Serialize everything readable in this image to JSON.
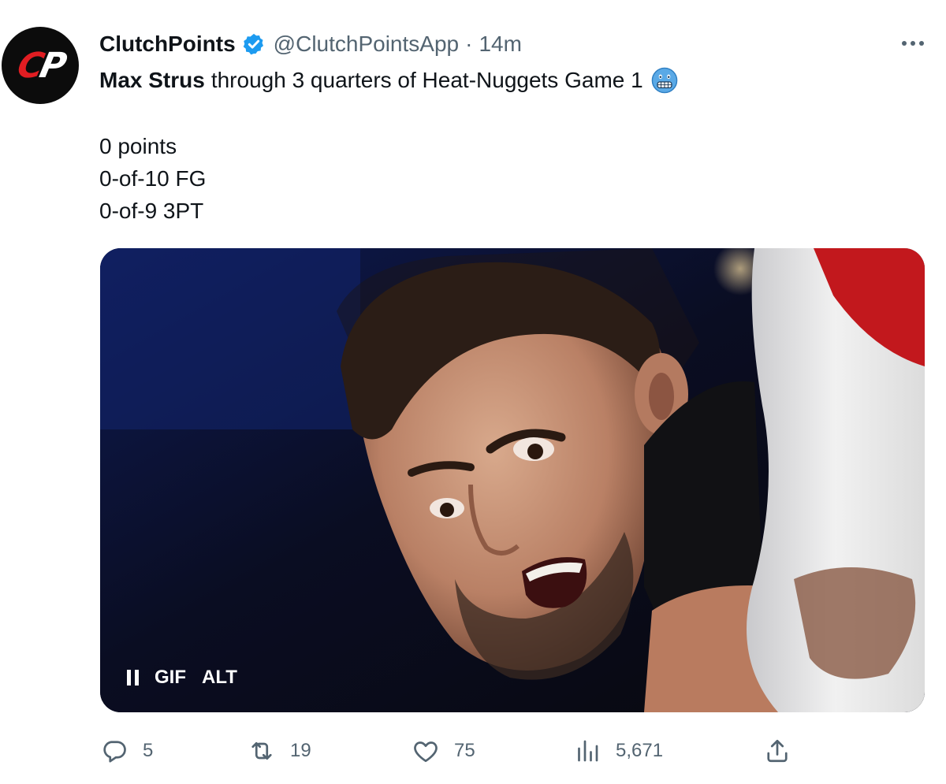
{
  "tweet": {
    "author": {
      "display_name": "ClutchPoints",
      "handle": "@ClutchPointsApp",
      "separator": "·",
      "time": "14m",
      "verified": true,
      "avatar_text": {
        "c": "C",
        "p": "P"
      },
      "avatar_colors": {
        "background": "#0c0c0c",
        "c": "#e11d22",
        "p": "#ffffff"
      },
      "verified_color": "#1d9bf0"
    },
    "text": {
      "bold": "Max Strus",
      "rest": "through 3 quarters of Heat-Nuggets Game 1",
      "emoji": "grimacing-face-icon",
      "lines": [
        "0 points",
        "0-of-10 FG",
        "0-of-9 3PT"
      ]
    },
    "media": {
      "type": "GIF",
      "pause_label": "pause",
      "gif_label": "GIF",
      "alt_label": "ALT"
    },
    "actions": {
      "replies": "5",
      "retweets": "19",
      "likes": "75",
      "views": "5,671"
    },
    "icons": {
      "reply": "reply-icon",
      "retweet": "retweet-icon",
      "like": "heart-icon",
      "views": "views-chart-icon",
      "share": "share-icon",
      "more": "more-dots-icon"
    }
  }
}
